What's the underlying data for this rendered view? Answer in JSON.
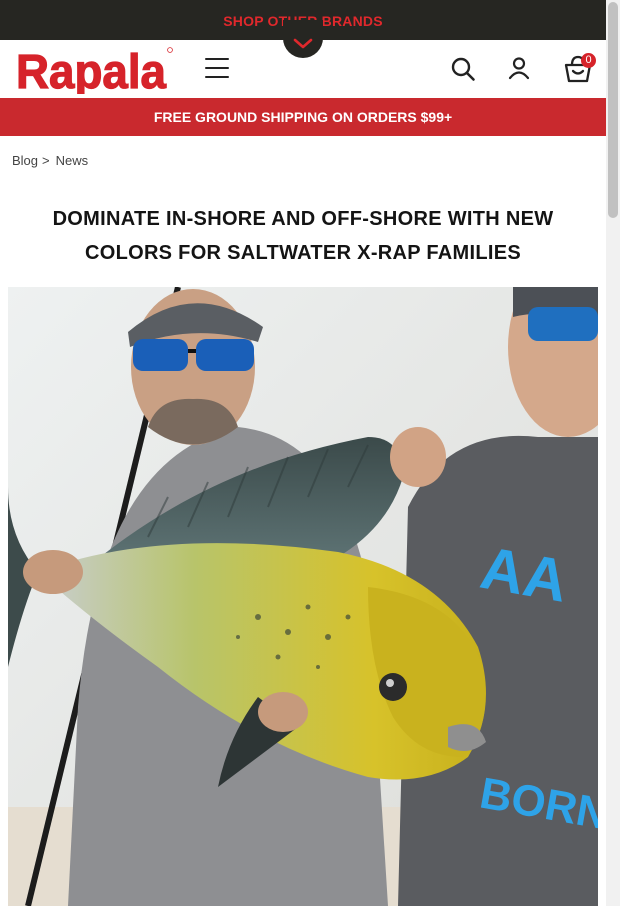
{
  "top_bar": {
    "label": "SHOP OTHER BRANDS"
  },
  "header": {
    "logo_text": "Rapala",
    "cart_count": "0"
  },
  "icons": {
    "toggle": "chevron-down-icon",
    "menu": "hamburger-icon",
    "search": "search-icon",
    "account": "user-icon",
    "cart": "cart-icon"
  },
  "shipping_banner": {
    "text": "FREE GROUND SHIPPING ON ORDERS $99+"
  },
  "breadcrumb": {
    "items": [
      {
        "label": "Blog"
      },
      {
        "label": "News"
      }
    ],
    "separator": ">"
  },
  "article": {
    "title_line1": "DOMINATE IN-SHORE AND OFF-SHORE WITH NEW",
    "title_line2": "COLORS FOR SALTWATER X-RAP FAMILIES",
    "hero_shirt_text": "BORN DI"
  },
  "colors": {
    "brand_red": "#e0282c",
    "banner_red": "#c9292e",
    "dark_bar": "#262622"
  }
}
